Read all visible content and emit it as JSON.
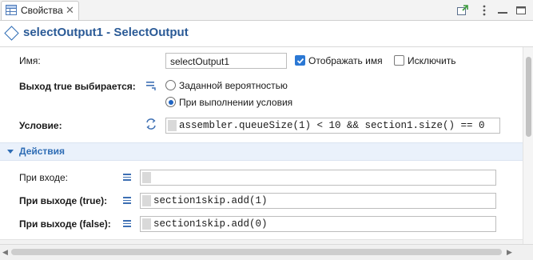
{
  "tab": {
    "title": "Свойства",
    "close": "✕"
  },
  "header": {
    "title": "selectOutput1 - SelectOutput"
  },
  "name_row": {
    "label": "Имя:",
    "value": "selectOutput1",
    "show_name_label": "Отображать имя",
    "show_name_checked": true,
    "exclude_label": "Исключить",
    "exclude_checked": false
  },
  "output_row": {
    "label": "Выход true выбирается:",
    "option_probability": "Заданной вероятностью",
    "option_condition": "При выполнении условия",
    "selected": "condition"
  },
  "condition_row": {
    "label": "Условие:",
    "code": "assembler.queueSize(1) < 10 && section1.size() == 0"
  },
  "actions": {
    "title": "Действия",
    "on_enter_label": "При входе:",
    "on_enter_code": "",
    "on_exit_true_label": "При выходе (true):",
    "on_exit_true_code": "section1skip.add(1)",
    "on_exit_false_label": "При выходе (false):",
    "on_exit_false_code": "section1skip.add(0)"
  },
  "colors": {
    "accent": "#2f6db5",
    "title": "#2a5a96",
    "section_bg": "#eaf1fb"
  }
}
